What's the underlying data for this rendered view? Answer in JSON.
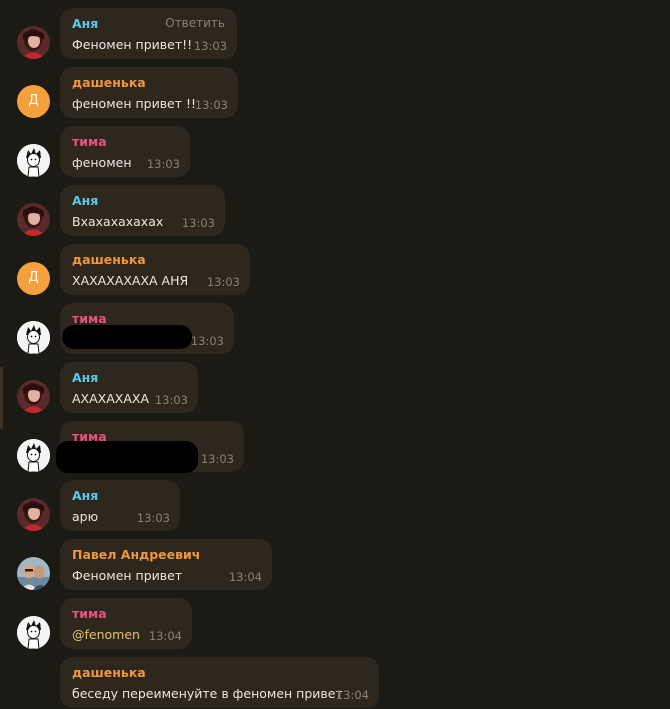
{
  "colors": {
    "background": "#1b1a14",
    "bubble": "#2d271d",
    "name_anya": "#5ac8e8",
    "name_dashenka": "#f0973e",
    "name_tima": "#e8527e",
    "name_pavel": "#f0973e",
    "time": "#8a8170"
  },
  "reply_label": "Ответить",
  "avatar_letter": "Д",
  "messages": [
    {
      "sender": "Аня",
      "text": "Феномен привет!!",
      "time": "13:03"
    },
    {
      "sender": "дашенька",
      "text": "феномен привет !!",
      "time": "13:03"
    },
    {
      "sender": "тима",
      "text": "феномен",
      "time": "13:03"
    },
    {
      "sender": "Аня",
      "text": "Вхахахахахах",
      "time": "13:03"
    },
    {
      "sender": "дашенька",
      "text": "ХАХАХАХАХА АНЯ",
      "time": "13:03"
    },
    {
      "sender": "тима",
      "text": "",
      "time": "13:03"
    },
    {
      "sender": "Аня",
      "text": "АХАХАХАХА",
      "time": "13:03"
    },
    {
      "sender": "тима",
      "text": "",
      "time": "13:03"
    },
    {
      "sender": "Аня",
      "text": "арю",
      "time": "13:03"
    },
    {
      "sender": "Павел Андреевич",
      "text": "Феномен привет",
      "time": "13:04"
    },
    {
      "sender": "тима",
      "text": "@fenomen",
      "time": "13:04"
    },
    {
      "sender": "дашенька",
      "text": "беседу переименуйте в феномен привет",
      "time": "13:04"
    }
  ]
}
